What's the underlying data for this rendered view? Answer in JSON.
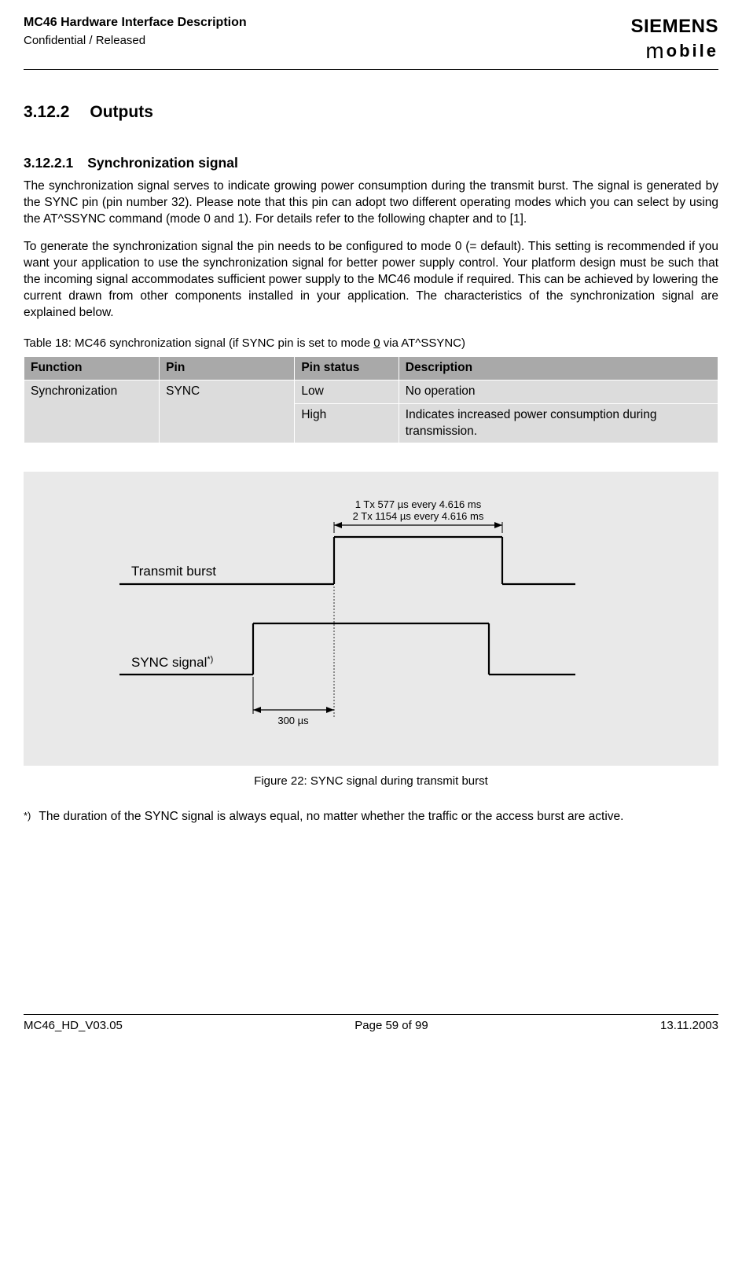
{
  "header": {
    "title": "MC46 Hardware Interface Description",
    "status": "Confidential / Released",
    "logo_top": "SIEMENS",
    "logo_bottom_m": "m",
    "logo_bottom_rest": "obile"
  },
  "section": {
    "num": "3.12.2",
    "title": "Outputs"
  },
  "subsection": {
    "num": "3.12.2.1",
    "title": "Synchronization signal"
  },
  "para1": "The synchronization signal serves to indicate growing power consumption during the transmit burst. The signal is generated by the SYNC pin (pin number 32). Please note that this pin can adopt two different operating modes which you can select by using the AT^SSYNC command (mode 0 and 1). For details refer to the following chapter and to [1].",
  "para2": "To generate the synchronization signal the pin needs to be configured to mode 0 (= default). This setting is recommended if you want your application to use the synchronization signal for better power supply control. Your platform design must be such that the incoming signal accommodates sufficient power supply to the MC46 module if required. This can be achieved by lowering the current drawn from other components installed in your application. The characteristics of the synchronization signal are explained below.",
  "table_caption_pre": "Table 18: MC46 synchronization signal (if SYNC pin is set to mode ",
  "table_caption_mode": "0",
  "table_caption_post": " via AT^SSYNC)",
  "table": {
    "headers": {
      "fn": "Function",
      "pin": "Pin",
      "status": "Pin status",
      "desc": "Description"
    },
    "rows": [
      {
        "fn": "Synchronization",
        "pin": "SYNC",
        "status": "Low",
        "desc": "No operation"
      },
      {
        "status": "High",
        "desc": "Indicates increased power consumption during transmission."
      }
    ]
  },
  "figure": {
    "timing_line1": "1 Tx   577 µs every 4.616 ms",
    "timing_line2": "2 Tx 1154 µs every 4.616 ms",
    "label_burst": "Transmit burst",
    "label_sync_pre": "SYNC signal",
    "label_sync_sup": "*)",
    "delay": "300 µs",
    "caption": "Figure 22: SYNC signal during transmit burst"
  },
  "footnote": {
    "marker": "*)",
    "text": "The duration of the SYNC signal is always equal, no matter whether the traffic or the access burst are active."
  },
  "footer": {
    "left": "MC46_HD_V03.05",
    "center": "Page 59 of 99",
    "right": "13.11.2003"
  }
}
